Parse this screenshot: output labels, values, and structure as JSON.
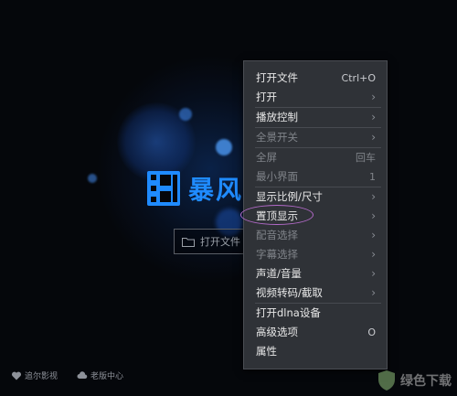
{
  "app": {
    "logo_text": "暴风",
    "open_file_button": "打开文件",
    "bottom_links": [
      "追尔影视",
      "老版中心"
    ]
  },
  "context_menu": {
    "items": [
      {
        "label": "打开文件",
        "shortcut": "Ctrl+O",
        "disabled": false,
        "submenu": false
      },
      {
        "label": "打开",
        "shortcut": "",
        "disabled": false,
        "submenu": true
      },
      {
        "label": "播放控制",
        "shortcut": "",
        "disabled": false,
        "submenu": true
      },
      {
        "label": "全景开关",
        "shortcut": "",
        "disabled": true,
        "submenu": true
      },
      {
        "label": "全屏",
        "shortcut": "回车",
        "disabled": true,
        "submenu": false
      },
      {
        "label": "最小界面",
        "shortcut": "1",
        "disabled": true,
        "submenu": false
      },
      {
        "label": "显示比例/尺寸",
        "shortcut": "",
        "disabled": false,
        "submenu": true
      },
      {
        "label": "置顶显示",
        "shortcut": "",
        "disabled": false,
        "submenu": true,
        "highlighted": true
      },
      {
        "label": "配音选择",
        "shortcut": "",
        "disabled": true,
        "submenu": true
      },
      {
        "label": "字幕选择",
        "shortcut": "",
        "disabled": true,
        "submenu": true
      },
      {
        "label": "声道/音量",
        "shortcut": "",
        "disabled": false,
        "submenu": true
      },
      {
        "label": "视频转码/截取",
        "shortcut": "",
        "disabled": false,
        "submenu": true
      },
      {
        "label": "打开dlna设备",
        "shortcut": "",
        "disabled": false,
        "submenu": false
      },
      {
        "label": "高级选项",
        "shortcut": "O",
        "disabled": false,
        "submenu": false
      },
      {
        "label": "属性",
        "shortcut": "",
        "disabled": false,
        "submenu": false
      }
    ],
    "arrow": "›"
  },
  "watermark": {
    "text": "绿色下载"
  },
  "colors": {
    "accent": "#1f8bff",
    "menu_bg": "#2f3237",
    "highlight": "#b36ac9"
  }
}
